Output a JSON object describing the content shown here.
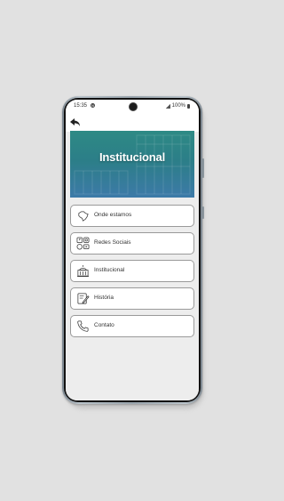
{
  "status": {
    "time": "15:35",
    "notification": "N",
    "battery": "100%"
  },
  "banner": {
    "title": "Institucional"
  },
  "menu": {
    "items": [
      {
        "label": "Onde estamos",
        "icon": "brazil-map-icon"
      },
      {
        "label": "Redes Sociais",
        "icon": "social-networks-icon"
      },
      {
        "label": "Institucional",
        "icon": "building-icon"
      },
      {
        "label": "História",
        "icon": "edit-document-icon"
      },
      {
        "label": "Contato",
        "icon": "phone-icon"
      }
    ]
  },
  "colors": {
    "banner_top": "#2e8a85",
    "banner_bottom": "#3d7aa8",
    "background": "#e1e1e1",
    "screen": "#ededed"
  }
}
